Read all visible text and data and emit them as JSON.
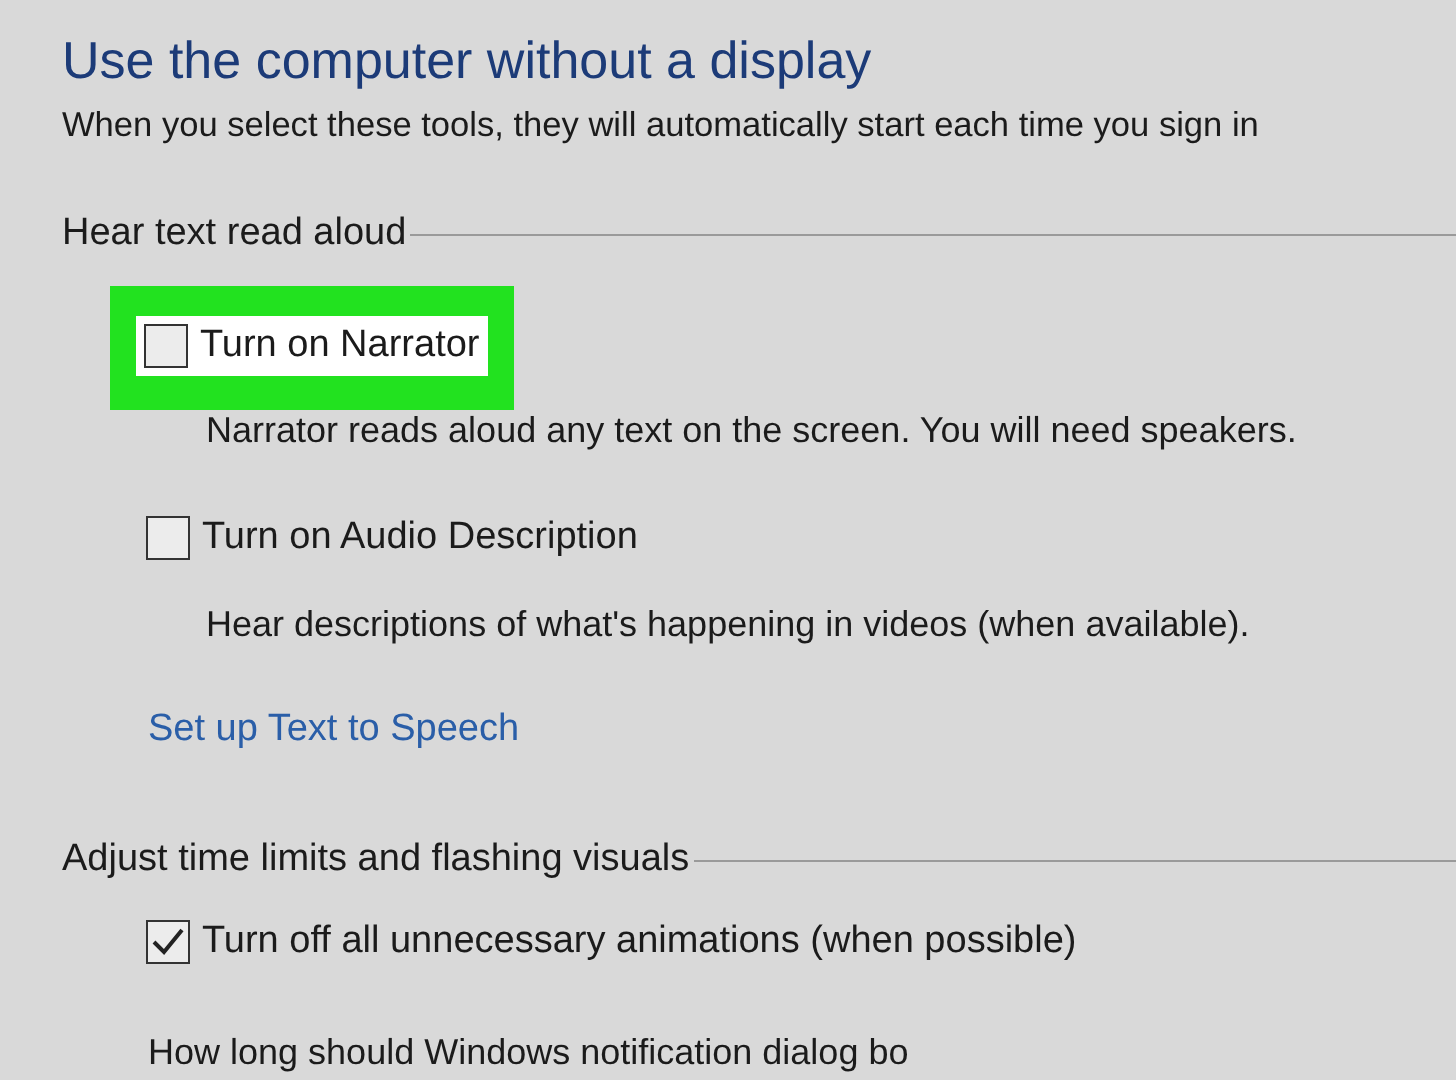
{
  "title": "Use the computer without a display",
  "subtitle": "When you select these tools, they will automatically start each time you sign in",
  "sections": [
    {
      "heading": "Hear text read aloud",
      "items": [
        {
          "kind": "checkbox",
          "label": "Turn on Narrator",
          "checked": false,
          "highlighted": true,
          "description": "Narrator reads aloud any text on the screen. You will need speakers."
        },
        {
          "kind": "checkbox",
          "label": "Turn on Audio Description",
          "checked": false,
          "highlighted": false,
          "description": "Hear descriptions of what's happening in videos (when available)."
        },
        {
          "kind": "link",
          "label": "Set up Text to Speech"
        }
      ]
    },
    {
      "heading": "Adjust time limits and flashing visuals",
      "items": [
        {
          "kind": "checkbox",
          "label": "Turn off all unnecessary animations (when possible)",
          "checked": true,
          "highlighted": false
        },
        {
          "kind": "text",
          "label": "How long should Windows notification dialog bo"
        }
      ]
    }
  ]
}
